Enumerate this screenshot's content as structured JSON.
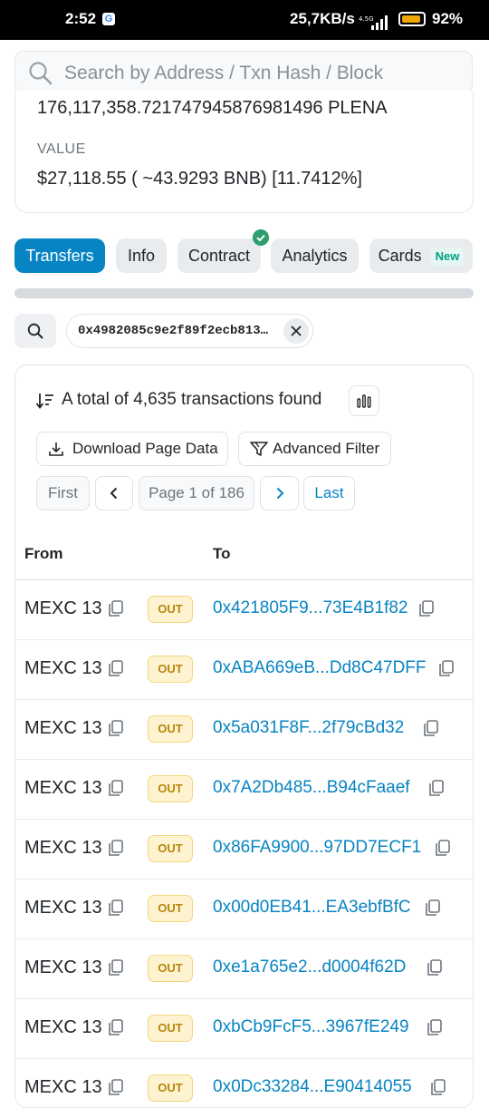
{
  "status_bar": {
    "time": "2:52",
    "network": "25,7KB/s",
    "net_type": "4.5G",
    "battery": "92%",
    "battery_level": 0.92
  },
  "search": {
    "placeholder": "Search by Address / Txn Hash / Block"
  },
  "overview": {
    "cut_text": "176,117,358.721747945876981496 PLENA",
    "value_label": "VALUE",
    "value_text": "$27,118.55 ( ~43.9293 BNB) [11.7412%]"
  },
  "tabs": [
    {
      "label": "Transfers"
    },
    {
      "label": "Info"
    },
    {
      "label": "Contract"
    },
    {
      "label": "Analytics"
    },
    {
      "label": "Cards",
      "badge": "New"
    }
  ],
  "filter": {
    "address": "0x4982085c9e2f89f2ecb8131..."
  },
  "transactions": {
    "total_text": "A total of 4,635 transactions found",
    "download_label": "Download Page Data",
    "advanced_filter_label": "Advanced Filter",
    "pagination": {
      "first": "First",
      "page": "Page 1 of 186",
      "last": "Last"
    },
    "columns": {
      "from": "From",
      "to": "To"
    },
    "rows": [
      {
        "from": "MEXC 13",
        "direction": "OUT",
        "to": "0x421805F9...73E4B1f82"
      },
      {
        "from": "MEXC 13",
        "direction": "OUT",
        "to": "0xABA669eB...Dd8C47DFF"
      },
      {
        "from": "MEXC 13",
        "direction": "OUT",
        "to": "0x5a031F8F...2f79cBd32"
      },
      {
        "from": "MEXC 13",
        "direction": "OUT",
        "to": "0x7A2Db485...B94cFaaef"
      },
      {
        "from": "MEXC 13",
        "direction": "OUT",
        "to": "0x86FA9900...97DD7ECF1"
      },
      {
        "from": "MEXC 13",
        "direction": "OUT",
        "to": "0x00d0EB41...EA3ebfBfC"
      },
      {
        "from": "MEXC 13",
        "direction": "OUT",
        "to": "0xe1a765e2...d0004f62D"
      },
      {
        "from": "MEXC 13",
        "direction": "OUT",
        "to": "0xbCb9FcF5...3967fE249"
      },
      {
        "from": "MEXC 13",
        "direction": "OUT",
        "to": "0x0Dc33284...E90414055"
      }
    ]
  },
  "colors": {
    "accent": "#0784c3",
    "out_badge_bg": "#fdf3d1",
    "out_badge_text": "#b8860b",
    "verified_green": "#2f9e6f"
  }
}
